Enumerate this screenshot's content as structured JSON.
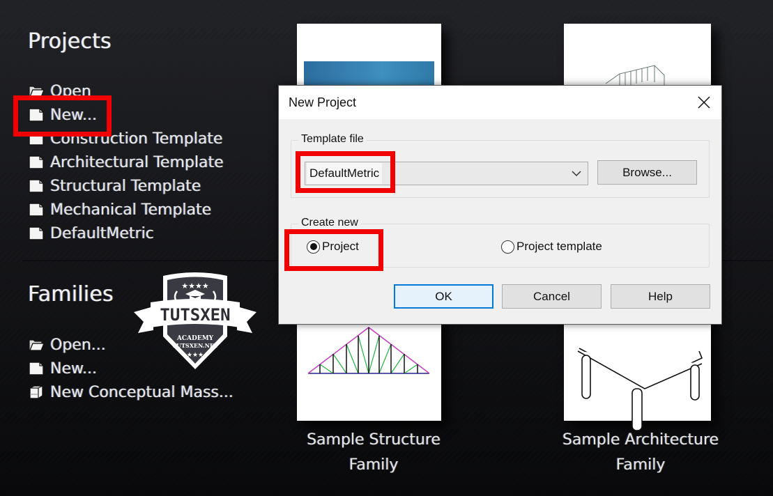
{
  "projects": {
    "title": "Projects",
    "items": [
      {
        "icon": "folder-open-icon",
        "label": "Open"
      },
      {
        "icon": "document-icon",
        "label": "New..."
      },
      {
        "icon": "document-icon",
        "label": "Construction Template"
      },
      {
        "icon": "document-icon",
        "label": "Architectural Template"
      },
      {
        "icon": "document-icon",
        "label": "Structural Template"
      },
      {
        "icon": "document-icon",
        "label": "Mechanical Template"
      },
      {
        "icon": "document-icon",
        "label": "DefaultMetric"
      }
    ]
  },
  "families": {
    "title": "Families",
    "items": [
      {
        "icon": "folder-open-icon",
        "label": "Open..."
      },
      {
        "icon": "document-icon",
        "label": "New..."
      },
      {
        "icon": "mass-cube-icon",
        "label": "New Conceptual Mass..."
      }
    ]
  },
  "watermark": {
    "brand": "TUTSXEN",
    "line1": "ACADEMY",
    "line2": "TUTSXEN.NET"
  },
  "cards": [
    {
      "caption_line1": "Sample Structure",
      "caption_line2": "Family"
    },
    {
      "caption_line1": "Sample Architecture",
      "caption_line2": "Family"
    }
  ],
  "dialog": {
    "title": "New Project",
    "close_icon": "close-icon",
    "template_group_label": "Template file",
    "template_value": "DefaultMetric",
    "browse_label": "Browse...",
    "create_group_label": "Create new",
    "radio_options": [
      {
        "label": "Project",
        "selected": true
      },
      {
        "label": "Project template",
        "selected": false
      }
    ],
    "ok_label": "OK",
    "cancel_label": "Cancel",
    "help_label": "Help"
  },
  "colors": {
    "highlight": "#f00000",
    "default_button_border": "#0078d7"
  }
}
